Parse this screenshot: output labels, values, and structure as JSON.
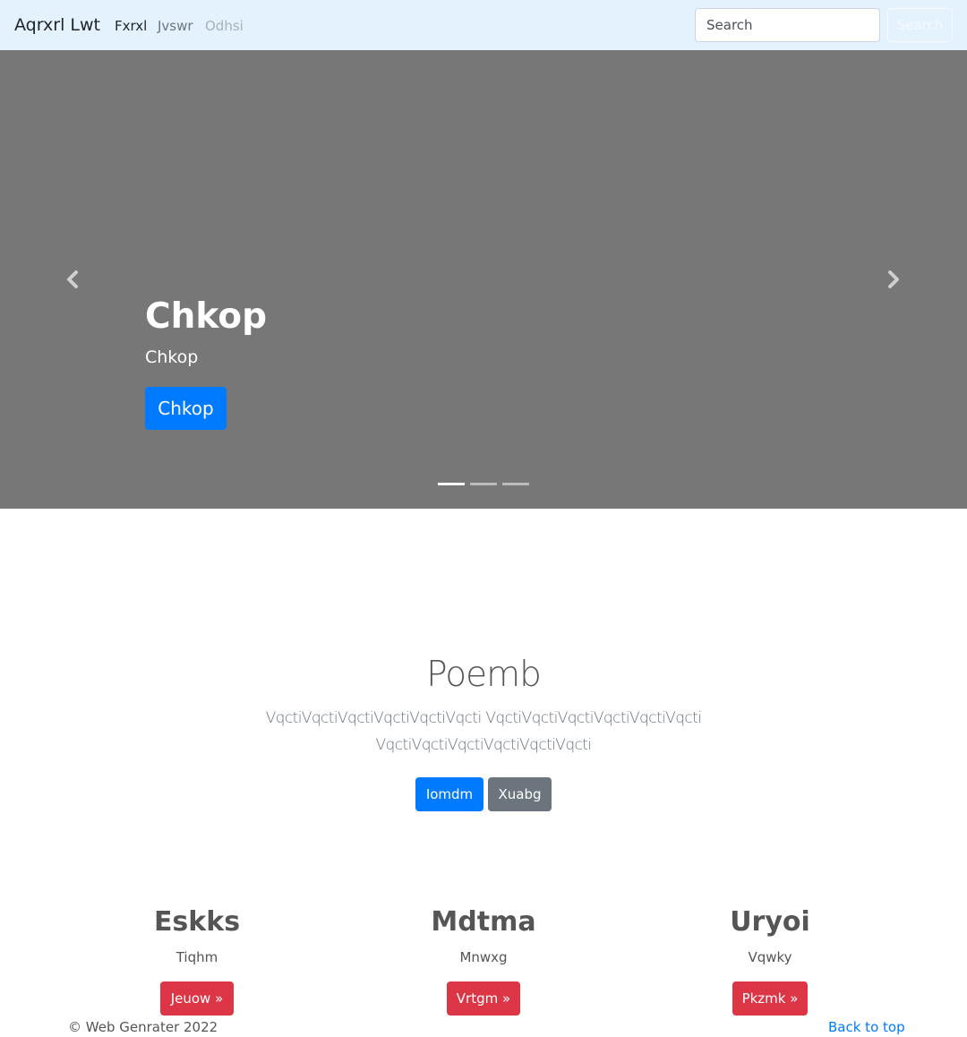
{
  "navbar": {
    "brand": "Aqrxrl Lwt",
    "links": [
      "Fxrxl",
      "Jvswr",
      "Odhsi"
    ],
    "search_placeholder": "Search",
    "search_button": "Search"
  },
  "carousel": {
    "title": "Chkop",
    "subtitle": "Chkop",
    "button": "Chkop",
    "slide_count": 3,
    "active_slide": 1,
    "background": "#777777"
  },
  "jumbotron": {
    "title": "Poemb",
    "lead": "VqctiVqctiVqctiVqctiVqctiVqcti VqctiVqctiVqctiVqctiVqctiVqcti VqctiVqctiVqctiVqctiVqctiVqcti",
    "primary_button": "Iomdm",
    "secondary_button": "Xuabg"
  },
  "columns": [
    {
      "title": "Eskks",
      "text": "Tiqhm",
      "button": "Jeuow »"
    },
    {
      "title": "Mdtma",
      "text": "Mnwxg",
      "button": "Vrtgm »"
    },
    {
      "title": "Uryoi",
      "text": "Vqwky",
      "button": "Pkzmk »"
    }
  ],
  "footer": {
    "copyright": "© Web Genrater 2022",
    "back_to_top": "Back to top"
  },
  "colors": {
    "navbar_bg": "#e3f2fd",
    "primary": "#007bff",
    "secondary": "#6c757d",
    "danger": "#dc3545"
  }
}
